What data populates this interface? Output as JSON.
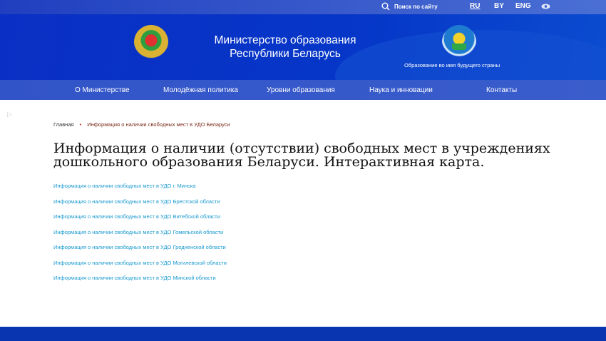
{
  "topbar": {
    "search_label": "Поиск по сайту",
    "languages": [
      "RU",
      "BY",
      "ENG"
    ],
    "icons": [
      "search-icon",
      "eye-icon"
    ]
  },
  "header": {
    "title_line1": "Министерство образования",
    "title_line2": "Республики Беларусь",
    "slogan": "Образование во имя будущего страны"
  },
  "nav": {
    "items": [
      "О Министерстве",
      "Молодёжная политика",
      "Уровни образования",
      "Наука и инновации",
      "Контакты"
    ]
  },
  "breadcrumb": {
    "home": "Главная",
    "current": "Информация о наличии свободных мест в УДО Беларуси"
  },
  "page_title": "Информация о наличии (отсутствии) свободных мест в учреждениях дошкольного образования Беларуси. Интерактивная карта.",
  "links": [
    "Информация о наличии свободных мест в УДО г. Минска",
    "Информация о наличии свободных мест в УДО Брестской области",
    "Информация о наличии свободных мест в УДО Витебской области",
    "Информация о наличии свободных мест в УДО Гомельской области",
    "Информация о наличии свободных мест в УДО Гродненской области",
    "Информация о наличии свободных мест в УДО Могилевской области",
    "Информация о наличии свободных мест в УДО Минской области"
  ],
  "colors": {
    "header": "#0a2fc4",
    "nav": "#3154c8",
    "link": "#1a9ad0",
    "footer": "#0a35b0"
  }
}
